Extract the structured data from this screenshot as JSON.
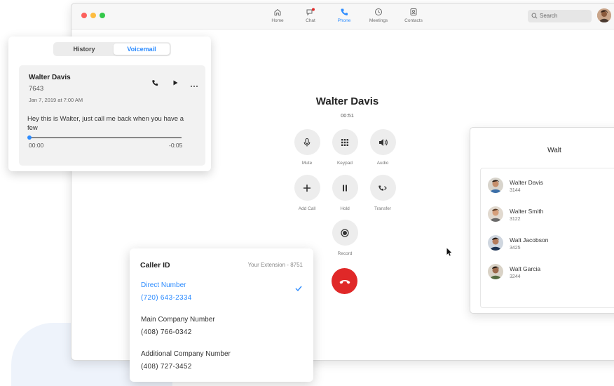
{
  "nav": {
    "items": [
      {
        "label": "Home",
        "icon": "home-icon"
      },
      {
        "label": "Chat",
        "icon": "chat-icon"
      },
      {
        "label": "Phone",
        "icon": "phone-icon"
      },
      {
        "label": "Meetings",
        "icon": "clock-icon"
      },
      {
        "label": "Contacts",
        "icon": "contacts-icon"
      }
    ],
    "active": "Phone",
    "search_placeholder": "Search"
  },
  "call": {
    "name": "Walter Davis",
    "timer": "00:51",
    "controls": [
      {
        "label": "Mute",
        "icon": "microphone-icon"
      },
      {
        "label": "Keypad",
        "icon": "keypad-icon"
      },
      {
        "label": "Audio",
        "icon": "speaker-icon"
      },
      {
        "label": "Add Call",
        "icon": "plus-icon"
      },
      {
        "label": "Hold",
        "icon": "pause-icon"
      },
      {
        "label": "Transfer",
        "icon": "transfer-icon"
      },
      {
        "label": "Record",
        "icon": "record-icon"
      }
    ]
  },
  "voicemail_panel": {
    "tabs": [
      "History",
      "Voicemail"
    ],
    "active_tab": "Voicemail",
    "entry": {
      "name": "Walter Davis",
      "extension": "7643",
      "date": "Jan 7, 2019 at 7:00 AM",
      "message": "Hey this is Walter, just call me back when you have a few",
      "time_start": "00:00",
      "time_end": "-0:05",
      "progress": 0.0
    }
  },
  "contact_search": {
    "query": "Walt",
    "results": [
      {
        "name": "Walter Davis",
        "ext": "3144"
      },
      {
        "name": "Walter Smith",
        "ext": "3122"
      },
      {
        "name": "Walt Jacobson",
        "ext": "3425"
      },
      {
        "name": "Walt Garcia",
        "ext": "3244"
      }
    ]
  },
  "caller_id": {
    "title": "Caller ID",
    "extension": "Your Extension - 8751",
    "options": [
      {
        "label": "Direct Number",
        "number": "(720) 643-2334",
        "selected": true
      },
      {
        "label": "Main Company Number",
        "number": "(408) 766-0342",
        "selected": false
      },
      {
        "label": "Additional Company Number",
        "number": "(408) 727-3452",
        "selected": false
      }
    ]
  },
  "colors": {
    "accent": "#2d8cff",
    "end_call": "#e02828"
  }
}
